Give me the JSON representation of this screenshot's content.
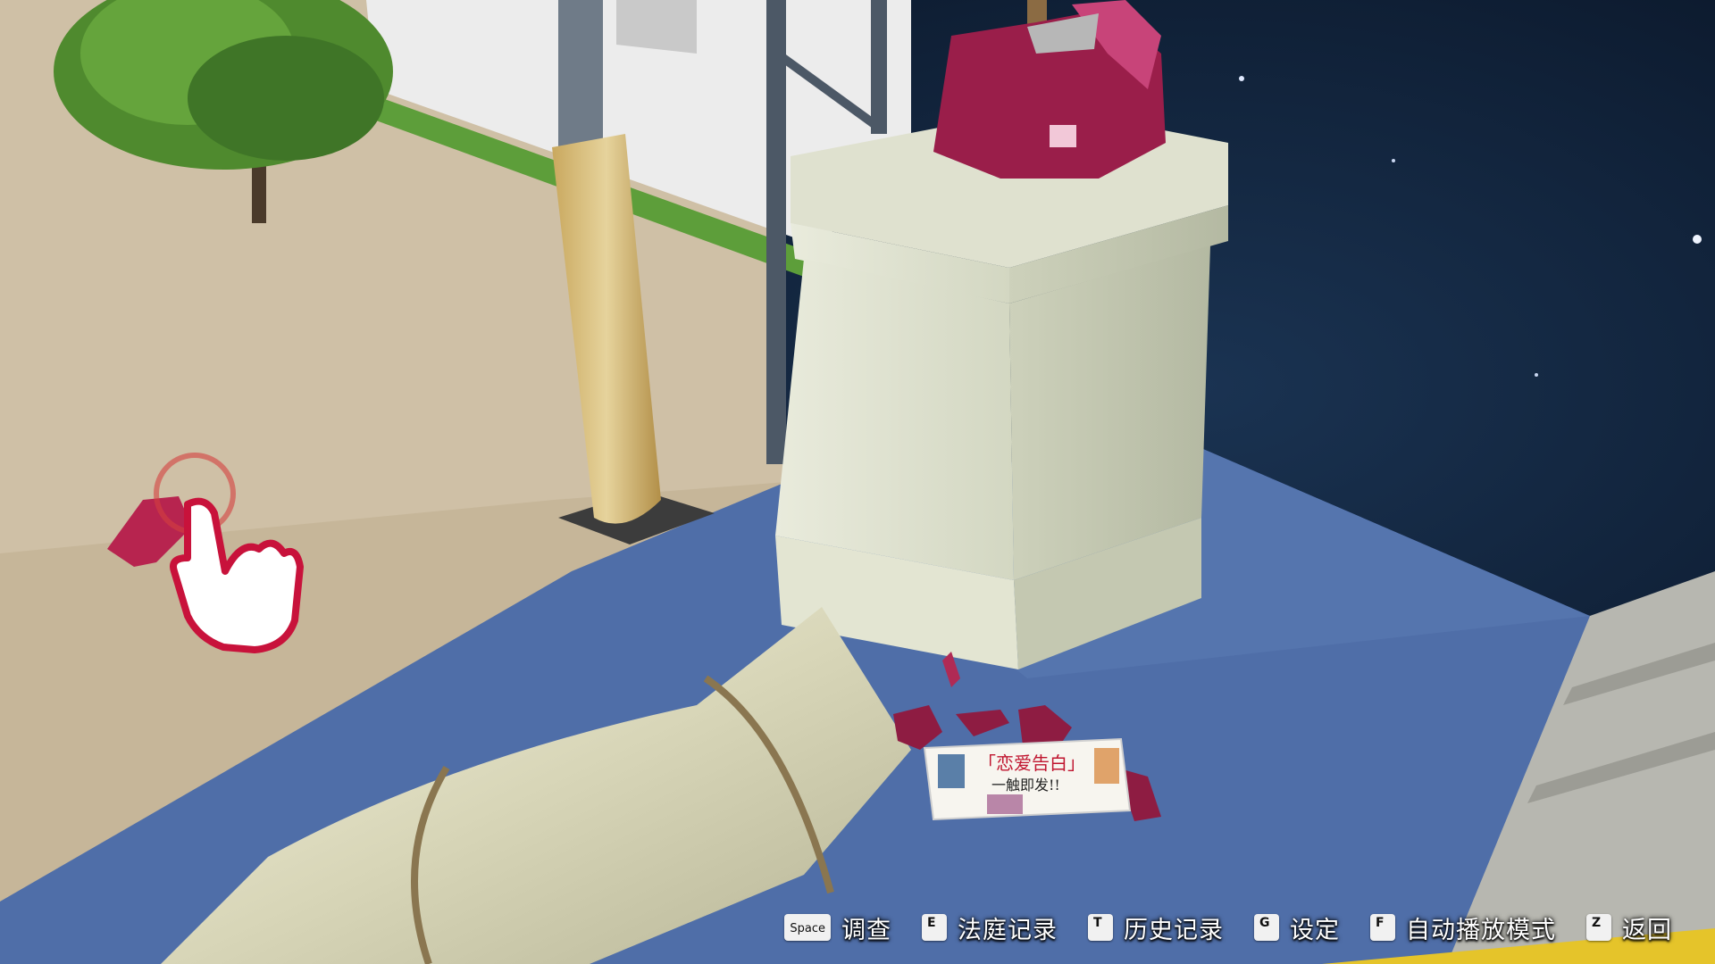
{
  "newspaper": {
    "headline": "「恋爱告白」",
    "subhead": "一触即发!!"
  },
  "hud": {
    "items": [
      {
        "key": "Space",
        "label": "调查"
      },
      {
        "key": "E",
        "label": "法庭记录"
      },
      {
        "key": "T",
        "label": "历史记录"
      },
      {
        "key": "G",
        "label": "设定"
      },
      {
        "key": "F",
        "label": "自动播放模式"
      },
      {
        "key": "Z",
        "label": "返回"
      }
    ]
  },
  "colors": {
    "floor": "#4f6ea8",
    "ground": "#cfc0a6",
    "sky": "#0f2036",
    "accent": "#c8123b"
  }
}
